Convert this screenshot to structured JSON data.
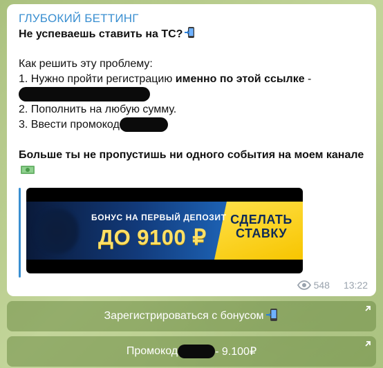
{
  "post": {
    "channel": "ГЛУБОКИЙ БЕТТИНГ",
    "headline": "Не успеваешь ставить на ТС?",
    "question": "Как решить эту проблему:",
    "step1_prefix": "1. Нужно пройти регистрацию ",
    "step1_bold": "именно по этой ссылке",
    "step1_suffix": " -",
    "step2": "2. Пополнить на любую сумму.",
    "step3_prefix": "3. Ввести промокод",
    "closing": "Больше ты не пропустишь ни одного события на моем канале",
    "views": "548",
    "time": "13:22"
  },
  "banner": {
    "subtitle": "БОНУС НА ПЕРВЫЙ ДЕПОЗИТ",
    "amount": "ДО 9100 ₽",
    "cta_line1": "СДЕЛАТЬ",
    "cta_line2": "СТАВКУ"
  },
  "buttons": {
    "register_label": "Зарегистрироваться с бонусом",
    "promo_prefix": "Промокод",
    "promo_suffix": " - 9.100₽"
  },
  "colors": {
    "channel": "#3a8fd1",
    "button_bg": "#6e8c46",
    "chat_bg": "#b5c98a",
    "banner_yellow": "#f7c500"
  },
  "icons": {
    "phone": "mobile-phone-arrow-emoji",
    "money": "money-with-wings-emoji",
    "views": "eye-icon",
    "button_corner": "arrow-up-right-icon"
  }
}
